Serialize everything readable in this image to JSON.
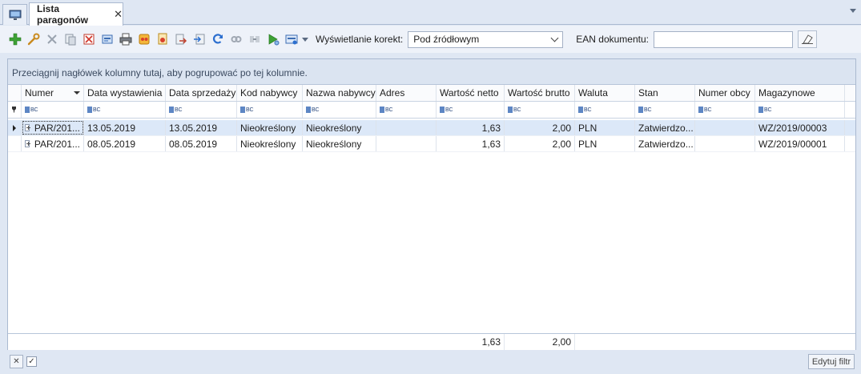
{
  "tabs": {
    "home_icon": "monitor-icon",
    "active_label": "Lista paragonów",
    "close_glyph": "✕"
  },
  "toolbar": {
    "buttons": [
      "add-icon",
      "edit-wrench-icon",
      "delete-icon",
      "copy-document-icon",
      "cancel-document-icon",
      "print-preview-icon",
      "print-icon",
      "generate-document-icon",
      "generate-correction-icon",
      "export-icon",
      "import-icon",
      "refresh-icon",
      "link-icon",
      "transfer-icon",
      "run-icon",
      "options-icon"
    ],
    "corrections_label": "Wyświetlanie korekt:",
    "corrections_value": "Pod źródłowym",
    "ean_label": "EAN dokumentu:",
    "ean_value": ""
  },
  "grid": {
    "group_hint": "Przeciągnij nagłówek kolumny tutaj, aby pogrupować po tej kolumnie.",
    "columns": [
      "Numer",
      "Data wystawienia",
      "Data sprzedaży",
      "Kod nabywcy",
      "Nazwa nabywcy",
      "Adres",
      "Wartość netto",
      "Wartość brutto",
      "Waluta",
      "Stan",
      "Numer obcy",
      "Magazynowe"
    ],
    "rows": [
      [
        "PAR/201...",
        "13.05.2019",
        "13.05.2019",
        "Nieokreślony",
        "Nieokreślony",
        "",
        "1,63",
        "2,00",
        "PLN",
        "Zatwierdzo...",
        "",
        "WZ/2019/00003"
      ],
      [
        "PAR/201...",
        "08.05.2019",
        "08.05.2019",
        "Nieokreślony",
        "Nieokreślony",
        "",
        "1,63",
        "2,00",
        "PLN",
        "Zatwierdzo...",
        "",
        "WZ/2019/00001"
      ]
    ],
    "totals": {
      "netto": "1,63",
      "brutto": "2,00"
    }
  },
  "filterbar": {
    "edit_filter_label": "Edytuj filtr",
    "clear_glyph": "✕",
    "check_glyph": "✓"
  },
  "colors": {
    "accent": "#2c6fcf",
    "selection": "#dce8f8",
    "panel_bg": "#dfe7f3"
  }
}
